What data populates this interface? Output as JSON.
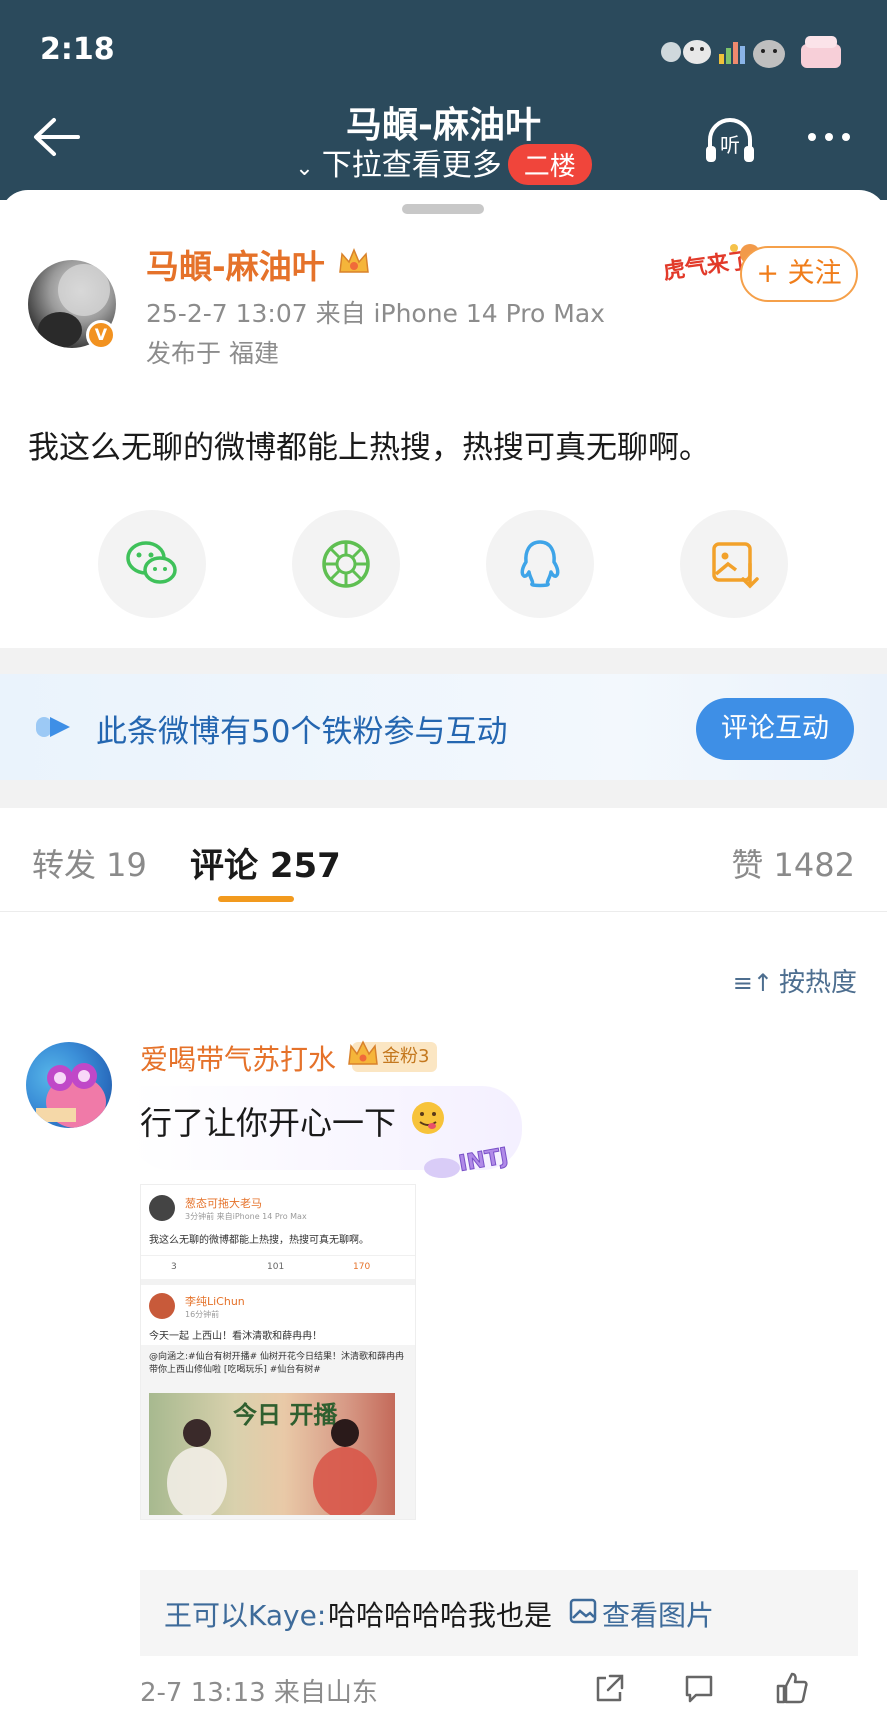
{
  "status_bar": {
    "time": "2:18"
  },
  "nav": {
    "title": "马頔-麻油叶",
    "subtitle": "下拉查看更多",
    "floor_badge": "二楼",
    "listen_label": "听"
  },
  "post": {
    "author": "马頔-麻油叶",
    "meta": "25-2-7 13:07   来自 iPhone 14 Pro Max",
    "location": "发布于 福建",
    "follow_label": "+ 关注",
    "text": "我这么无聊的微博都能上热搜，热搜可真无聊啊。",
    "share_targets": [
      "wechat-icon",
      "moments-icon",
      "qq-icon",
      "save-image-icon"
    ]
  },
  "fans_banner": {
    "text": "此条微博有50个铁粉参与互动",
    "button_label": "评论互动"
  },
  "tabs": {
    "repost": "转发 19",
    "comment": "评论 257",
    "like": "赞 1482"
  },
  "sort": {
    "label": "按热度"
  },
  "comment": {
    "author": "爱喝带气苏打水",
    "badge": "金粉3",
    "text": "行了让你开心一下",
    "sticker_text": "INTJ",
    "screenshot": {
      "name": "葱态可拖大老马",
      "meta": "3分钟前  来自iPhone 14 Pro Max",
      "text": "我这么无聊的微博都能上热搜，热搜可真无聊啊。",
      "reposts": "3",
      "comments": "101",
      "likes": "170",
      "name2": "李纯LiChun",
      "meta2": "16分钟前",
      "text2": "今天一起 上西山！看沐清歌和薛冉冉！",
      "quote_text": "@向涵之:#仙台有树开播# 仙树开花今日结果！沐清歌和薛冉冉带你上西山修仙啦 [吃喝玩乐] #仙台有树#",
      "poster_text": "今日 开播"
    },
    "reply": {
      "name": "王可以Kaye:",
      "text": "哈哈哈哈哈我也是",
      "image_link": "查看图片"
    },
    "footer": "2-7 13:13  来自山东"
  },
  "colors": {
    "header_bg": "#2b4a5c",
    "accent_orange": "#e5722a",
    "link_blue": "#3e6b9a",
    "button_blue": "#3e8fe6"
  }
}
